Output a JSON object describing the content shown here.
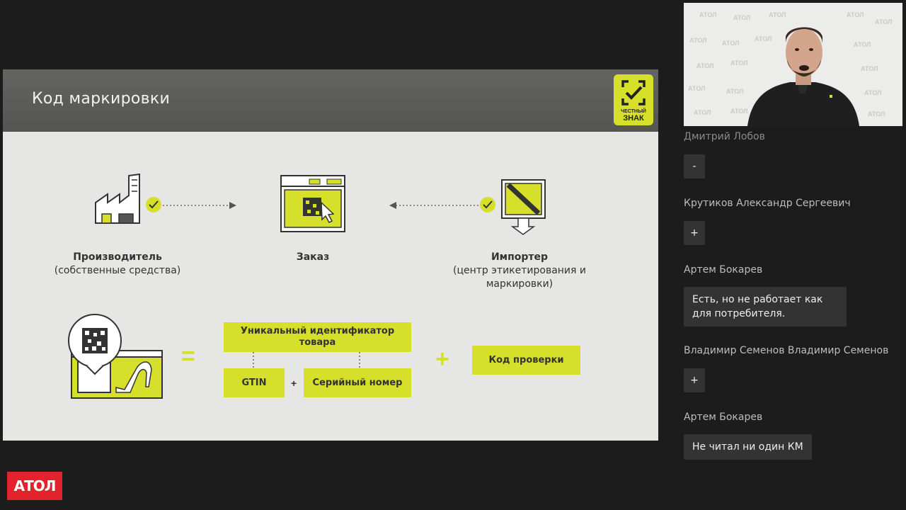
{
  "slide": {
    "title": "Код маркировки",
    "logo": {
      "line1": "ЧЕСТНЫЙ",
      "line2": "ЗНАК"
    },
    "flow": [
      {
        "name": "Производитель",
        "sub": "(собственные средства)"
      },
      {
        "name": "Заказ",
        "sub": ""
      },
      {
        "name": "Импортер",
        "sub": "(центр этикетирования и маркировки)"
      }
    ],
    "formula": {
      "equals": "=",
      "unique_id": "Уникальный идентификатор товара",
      "gtin": "GTIN",
      "plus_small": "+",
      "serial": "Серийный номер",
      "plus_big": "+",
      "check_code": "Код проверки"
    },
    "accent_color": "#d6e02a"
  },
  "chat": [
    {
      "author": "Дмитрий Лобов",
      "message": "-"
    },
    {
      "author": "Крутиков Александр Сергеевич",
      "message": "+"
    },
    {
      "author": "Артем Бокарев",
      "message": "Есть, но не работает как для потребителя."
    },
    {
      "author": "Владимир Семенов Владимир Семенов",
      "message": "+"
    },
    {
      "author": "Артем Бокарев",
      "message": "Не читал ни один КМ"
    }
  ],
  "brand": {
    "logo_text": "АТОЛ",
    "color": "#e3232b"
  },
  "video": {
    "icon": "presenter-video"
  }
}
